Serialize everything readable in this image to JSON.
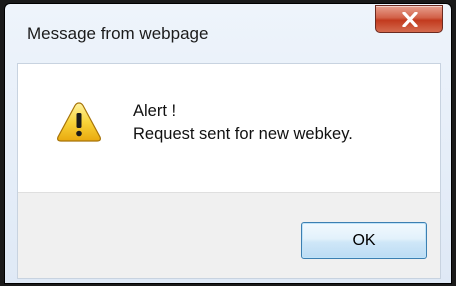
{
  "dialog": {
    "title": "Message from webpage",
    "icon": "warning-triangle-icon",
    "message_lines": [
      "Alert !",
      "Request sent for new webkey."
    ],
    "ok_label": "OK"
  },
  "colors": {
    "close_button": "#c8452a",
    "ok_border": "#3c7fb1",
    "warning_yellow": "#f5c518"
  }
}
